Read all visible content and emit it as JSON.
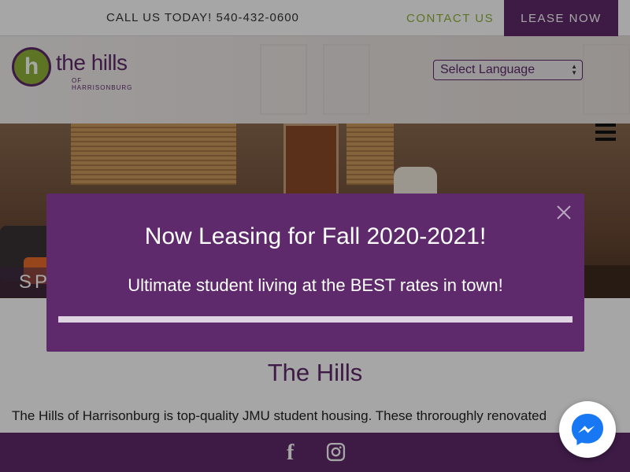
{
  "topbar": {
    "call_text": "CALL US TODAY! 540-432-0600",
    "contact_label": "CONTACT US",
    "lease_label": "LEASE NOW"
  },
  "header": {
    "logo_name": "the hills",
    "logo_subtitle": "OF HARRISONBURG",
    "language_select": "Select Language"
  },
  "hero": {
    "caption": "SP"
  },
  "main": {
    "title": "The Hills",
    "intro": "The Hills of Harrisonburg is top-quality JMU student housing. These throroughly renovated"
  },
  "popup": {
    "title": "Now Leasing for Fall 2020-2021!",
    "subtitle": "Ultimate student living at the BEST rates in town!"
  },
  "footer": {
    "icons": [
      "facebook-icon",
      "instagram-icon"
    ]
  },
  "colors": {
    "brand_purple": "#5e2a6b",
    "accent_green": "#8fb339",
    "messenger_blue": "#1877f2"
  }
}
